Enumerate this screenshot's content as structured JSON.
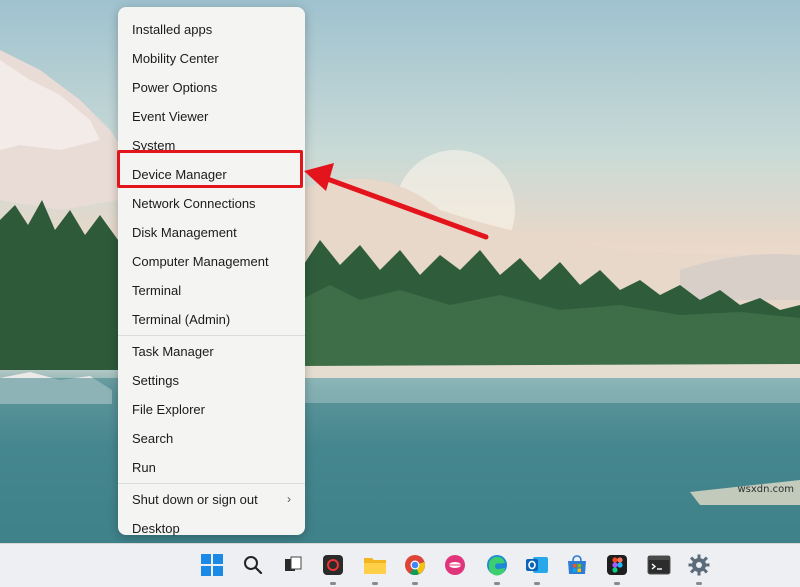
{
  "menu": {
    "items": [
      {
        "label": "Installed apps"
      },
      {
        "label": "Mobility Center"
      },
      {
        "label": "Power Options"
      },
      {
        "label": "Event Viewer"
      },
      {
        "label": "System"
      },
      {
        "label": "Device Manager"
      },
      {
        "label": "Network Connections"
      },
      {
        "label": "Disk Management"
      },
      {
        "label": "Computer Management"
      },
      {
        "label": "Terminal"
      },
      {
        "label": "Terminal (Admin)"
      },
      {
        "label": "Task Manager"
      },
      {
        "label": "Settings"
      },
      {
        "label": "File Explorer"
      },
      {
        "label": "Search"
      },
      {
        "label": "Run"
      },
      {
        "label": "Shut down or sign out"
      },
      {
        "label": "Desktop"
      }
    ],
    "highlighted": "Device Manager",
    "highlight_color": "#e4141d"
  },
  "taskbar": {
    "icons": [
      "windows-start-icon",
      "search-icon",
      "task-view-icon",
      "media-app-icon",
      "file-explorer-icon",
      "chrome-icon",
      "lips-app-icon",
      "edge-icon",
      "outlook-icon",
      "microsoft-store-icon",
      "figma-icon",
      "terminal-icon",
      "settings-icon"
    ]
  },
  "watermark": "wsxdn.com"
}
